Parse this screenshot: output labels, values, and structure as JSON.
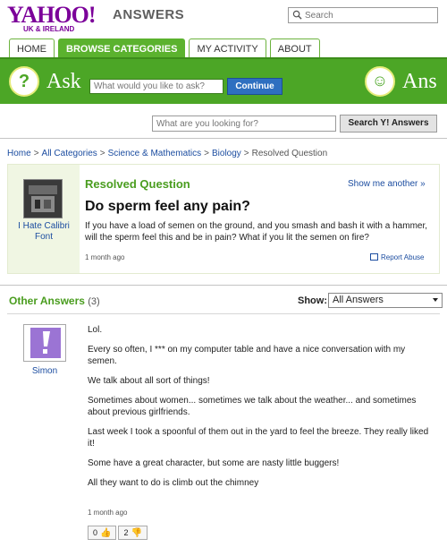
{
  "header": {
    "logo_text": "YAHOO!",
    "logo_region": "UK & IRELAND",
    "section_title": "ANSWERS",
    "search_placeholder": "Search"
  },
  "tabs": [
    {
      "label": "HOME",
      "active": false
    },
    {
      "label": "BROWSE CATEGORIES",
      "active": true
    },
    {
      "label": "MY ACTIVITY",
      "active": false
    },
    {
      "label": "ABOUT",
      "active": false
    }
  ],
  "ask_bar": {
    "ask_label": "Ask",
    "ask_placeholder": "What would you like to ask?",
    "continue_label": "Continue",
    "answer_label": "Ans"
  },
  "search_bar": {
    "placeholder": "What are you looking for?",
    "button_label": "Search Y! Answers"
  },
  "breadcrumb": [
    {
      "label": "Home",
      "link": true
    },
    {
      "label": "All Categories",
      "link": true
    },
    {
      "label": "Science & Mathematics",
      "link": true
    },
    {
      "label": "Biology",
      "link": true
    },
    {
      "label": "Resolved Question",
      "link": false
    }
  ],
  "question": {
    "status_title": "Resolved Question",
    "show_another": "Show me another »",
    "asker_name": "I Hate Calibri Font",
    "title": "Do sperm feel any pain?",
    "body": "If you have a load of semen on the ground, and you smash and bash it with a hammer, will the sperm feel this and be in pain? What if you lit the semen on fire?",
    "time": "1 month ago",
    "report_abuse": "Report Abuse"
  },
  "answers_section": {
    "title": "Other Answers",
    "count": "(3)",
    "show_label": "Show:",
    "show_selected": "All Answers"
  },
  "answer": {
    "author": "Simon",
    "paragraphs": [
      "Lol.",
      "Every so often, I *** on my computer table and have a nice conversation with my semen.",
      "We talk about all sort of things!",
      "Sometimes about women... sometimes we talk about the weather... and sometimes about previous girlfriends.",
      "Last week I took a spoonful of them out in the yard to feel the breeze. They really liked it!",
      "Some have a great character, but some are nasty little buggers!",
      "All they want to do is climb out the chimney"
    ],
    "time": "1 month ago",
    "thumbs_up": "0",
    "thumbs_down": "2"
  },
  "colors": {
    "yahoo_purple": "#7b0099",
    "green": "#4ca626",
    "link_blue": "#1c4da0"
  }
}
